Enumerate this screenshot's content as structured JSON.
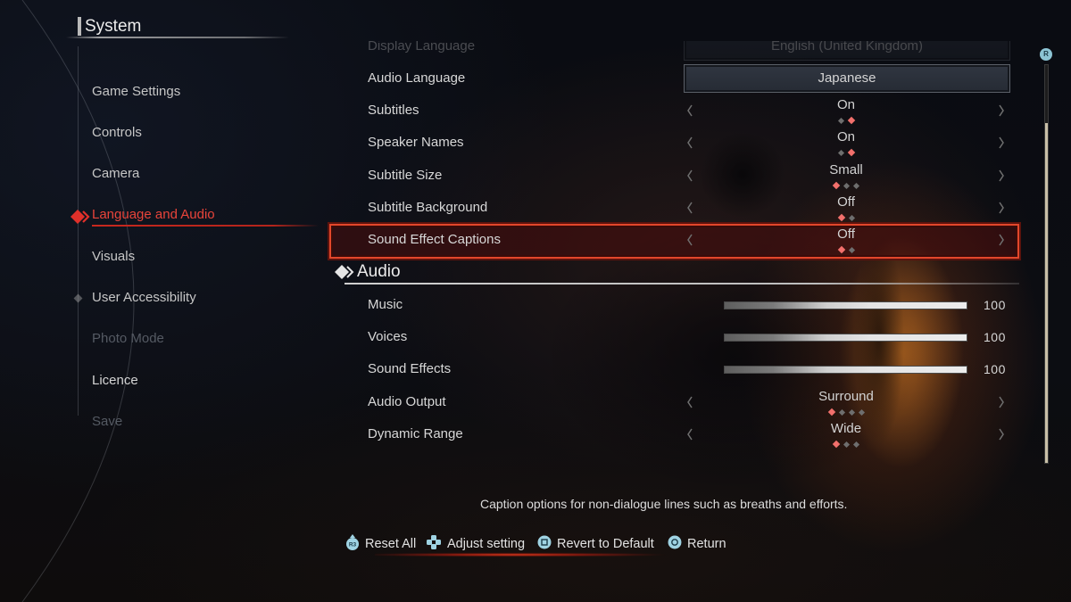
{
  "theme": {
    "accent": "#e2472b",
    "accent_text": "#e8443a",
    "dot_active": "#f2706c",
    "dot_inactive": "#6e6e6e",
    "hint_icon": "#9fd3e3"
  },
  "sidebar": {
    "title": "System",
    "items": [
      {
        "label": "Game Settings",
        "state": "normal"
      },
      {
        "label": "Controls",
        "state": "normal"
      },
      {
        "label": "Camera",
        "state": "normal"
      },
      {
        "label": "Language and Audio",
        "state": "active"
      },
      {
        "label": "Visuals",
        "state": "normal"
      },
      {
        "label": "User Accessibility",
        "state": "normal"
      },
      {
        "label": "Photo Mode",
        "state": "disabled"
      },
      {
        "label": "Licence",
        "state": "normal"
      },
      {
        "label": "Save",
        "state": "disabled"
      }
    ]
  },
  "language_section": {
    "display_language": {
      "label": "Display Language",
      "value": "English (United Kingdom)",
      "type": "dropdown"
    },
    "audio_language": {
      "label": "Audio Language",
      "value": "Japanese",
      "type": "dropdown"
    },
    "subtitles": {
      "label": "Subtitles",
      "value": "On",
      "options_count": 2,
      "selected_index": 1
    },
    "speaker_names": {
      "label": "Speaker Names",
      "value": "On",
      "options_count": 2,
      "selected_index": 1
    },
    "subtitle_size": {
      "label": "Subtitle Size",
      "value": "Small",
      "options_count": 3,
      "selected_index": 0
    },
    "subtitle_background": {
      "label": "Subtitle Background",
      "value": "Off",
      "options_count": 2,
      "selected_index": 0
    },
    "sound_effect_captions": {
      "label": "Sound Effect Captions",
      "value": "Off",
      "options_count": 2,
      "selected_index": 0,
      "focused": true
    }
  },
  "audio_section": {
    "title": "Audio",
    "music": {
      "label": "Music",
      "value": 100,
      "max": 100
    },
    "voices": {
      "label": "Voices",
      "value": 100,
      "max": 100
    },
    "sound_effects": {
      "label": "Sound Effects",
      "value": 100,
      "max": 100
    },
    "audio_output": {
      "label": "Audio Output",
      "value": "Surround",
      "options_count": 4,
      "selected_index": 0
    },
    "dynamic_range": {
      "label": "Dynamic Range",
      "value": "Wide",
      "options_count": 3,
      "selected_index": 0
    }
  },
  "scrollbar": {
    "button_label": "R",
    "visible_fraction": 0.855,
    "scroll_fraction": 1.0
  },
  "description": "Caption options for non-dialogue lines such as breaths and efforts.",
  "button_hints": [
    {
      "icon": "r3-button-icon",
      "icon_text": "R3",
      "label": "Reset All"
    },
    {
      "icon": "dpad-icon",
      "label": "Adjust setting"
    },
    {
      "icon": "square-button-icon",
      "label": "Revert to Default"
    },
    {
      "icon": "circle-button-icon",
      "label": "Return"
    }
  ]
}
